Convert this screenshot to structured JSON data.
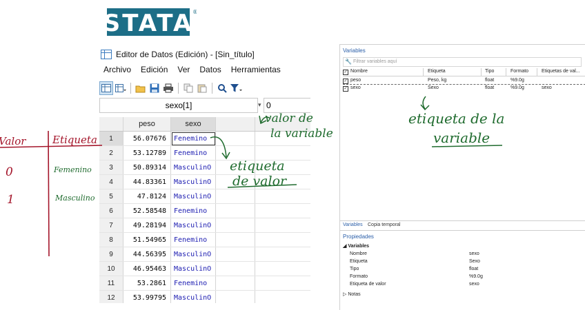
{
  "logo": {
    "text": "STATA",
    "registered": "®",
    "color": "#1d6e87"
  },
  "editor": {
    "title": "Editor de Datos (Edición) - [Sin_título]",
    "menu": [
      "Archivo",
      "Edición",
      "Ver",
      "Datos",
      "Herramientas"
    ],
    "toolbar_icons": [
      "data-editor-icon",
      "data-browser-icon",
      "open-folder-icon",
      "save-icon",
      "print-icon",
      "copy-icon",
      "paste-icon",
      "search-icon",
      "filter-icon"
    ],
    "cell_ref": "sexo[1]",
    "cell_value": "0",
    "columns": [
      "peso",
      "sexo"
    ],
    "rows": [
      {
        "n": "1",
        "peso": "56.07676",
        "sexo": "Fenemino"
      },
      {
        "n": "2",
        "peso": "53.12789",
        "sexo": "Fenemino"
      },
      {
        "n": "3",
        "peso": "50.89314",
        "sexo": "MasculinO"
      },
      {
        "n": "4",
        "peso": "44.83361",
        "sexo": "MasculinO"
      },
      {
        "n": "5",
        "peso": "47.8124",
        "sexo": "MasculinO"
      },
      {
        "n": "6",
        "peso": "52.58548",
        "sexo": "Fenemino"
      },
      {
        "n": "7",
        "peso": "49.28194",
        "sexo": "MasculinO"
      },
      {
        "n": "8",
        "peso": "51.54965",
        "sexo": "Fenemino"
      },
      {
        "n": "9",
        "peso": "44.56395",
        "sexo": "MasculinO"
      },
      {
        "n": "10",
        "peso": "46.95463",
        "sexo": "MasculinO"
      },
      {
        "n": "11",
        "peso": "53.2861",
        "sexo": "Fenemino"
      },
      {
        "n": "12",
        "peso": "53.99795",
        "sexo": "MasculinO"
      }
    ]
  },
  "variables_panel": {
    "title": "Variables",
    "filter_placeholder": "Filtrar variables aquí",
    "headers": [
      "Nombre",
      "Etiqueta",
      "Tipo",
      "Formato",
      "Etiquetas de val..."
    ],
    "rows": [
      {
        "name": "peso",
        "label": "Peso, kg",
        "type": "float",
        "format": "%9.0g",
        "vallabel": ""
      },
      {
        "name": "sexo",
        "label": "Sexo",
        "type": "float",
        "format": "%9.0g",
        "vallabel": "sexo"
      }
    ],
    "tabs": [
      "Variables",
      "Copia temporal"
    ]
  },
  "properties_panel": {
    "title": "Propiedades",
    "section": "Variables",
    "notes": "Notas",
    "props": [
      {
        "key": "Nombre",
        "value": "sexo"
      },
      {
        "key": "Etiqueta",
        "value": "Sexo"
      },
      {
        "key": "Tipo",
        "value": "float"
      },
      {
        "key": "Formato",
        "value": "%9.0g"
      },
      {
        "key": "Etiqueta de valor",
        "value": "sexo"
      }
    ]
  },
  "annotations": {
    "valor": "Valor",
    "etiqueta": "Etiqueta",
    "v0": "0",
    "v1": "1",
    "femenino": "Femenino",
    "masculino": "Masculino",
    "valor_de": "valor de",
    "la_variable": "la variable",
    "etiqueta_hw": "etiqueta",
    "de_valor": "de valor",
    "etiqueta_de_la": "etiqueta de la",
    "variable_hw": "variable"
  },
  "colors": {
    "handwriting_green": "#1f6b2e",
    "handwriting_red": "#a4152a",
    "value_label_blue": "#1a1ab0",
    "panel_title_blue": "#2a5ea8"
  }
}
